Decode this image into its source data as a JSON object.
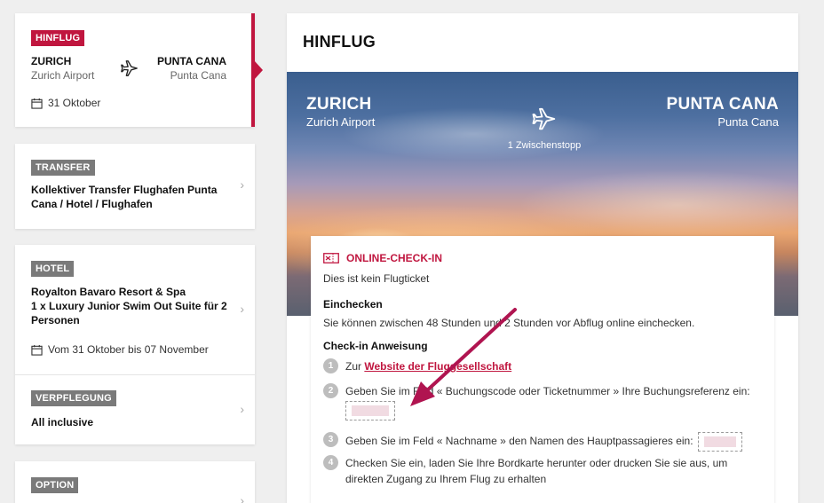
{
  "sidebar": {
    "hinflug": {
      "badge": "HINFLUG",
      "from_city": "ZURICH",
      "from_airport": "Zurich Airport",
      "to_city": "PUNTA CANA",
      "to_airport": "Punta Cana",
      "date": "31 Oktober"
    },
    "transfer": {
      "badge": "TRANSFER",
      "line1": "Kollektiver Transfer Flughafen Punta",
      "line2": "Cana / Hotel / Flughafen"
    },
    "hotel": {
      "badge": "HOTEL",
      "line1": "Royalton Bavaro Resort & Spa",
      "line2": "1 x Luxury Junior Swim Out Suite für 2",
      "line3": "Personen",
      "dates": "Vom 31 Oktober bis 07 November"
    },
    "verpflegung": {
      "badge": "VERPFLEGUNG",
      "value": "All inclusive"
    },
    "option": {
      "badge": "OPTION"
    }
  },
  "main": {
    "title": "HINFLUG",
    "hero": {
      "from_city": "ZURICH",
      "from_airport": "Zurich Airport",
      "to_city": "PUNTA CANA",
      "to_airport": "Punta Cana",
      "stops": "1 Zwischenstopp"
    },
    "checkin": {
      "header": "ONLINE-CHECK-IN",
      "not_ticket": "Dies ist kein Flugticket",
      "einchecken_title": "Einchecken",
      "einchecken_text": "Sie können zwischen 48 Stunden und 2 Stunden vor Abflug online einchecken.",
      "anweisung_title": "Check-in Anweisung",
      "steps": [
        {
          "num": "1",
          "prefix": "Zur ",
          "link": "Website der Fluggesellschaft"
        },
        {
          "num": "2",
          "text": "Geben Sie im Feld « Buchungscode oder Ticketnummer » Ihre Buchungsreferenz ein:"
        },
        {
          "num": "3",
          "text": "Geben Sie im Feld « Nachname » den Namen des Hauptpassagieres ein:"
        },
        {
          "num": "4",
          "line1": "Checken Sie ein, laden Sie Ihre Bordkarte herunter oder drucken Sie sie aus, um",
          "line2": "direkten Zugang zu Ihrem Flug zu erhalten"
        }
      ]
    }
  },
  "colors": {
    "accent": "#c0163f",
    "badge_gray": "#7a7a7a"
  }
}
